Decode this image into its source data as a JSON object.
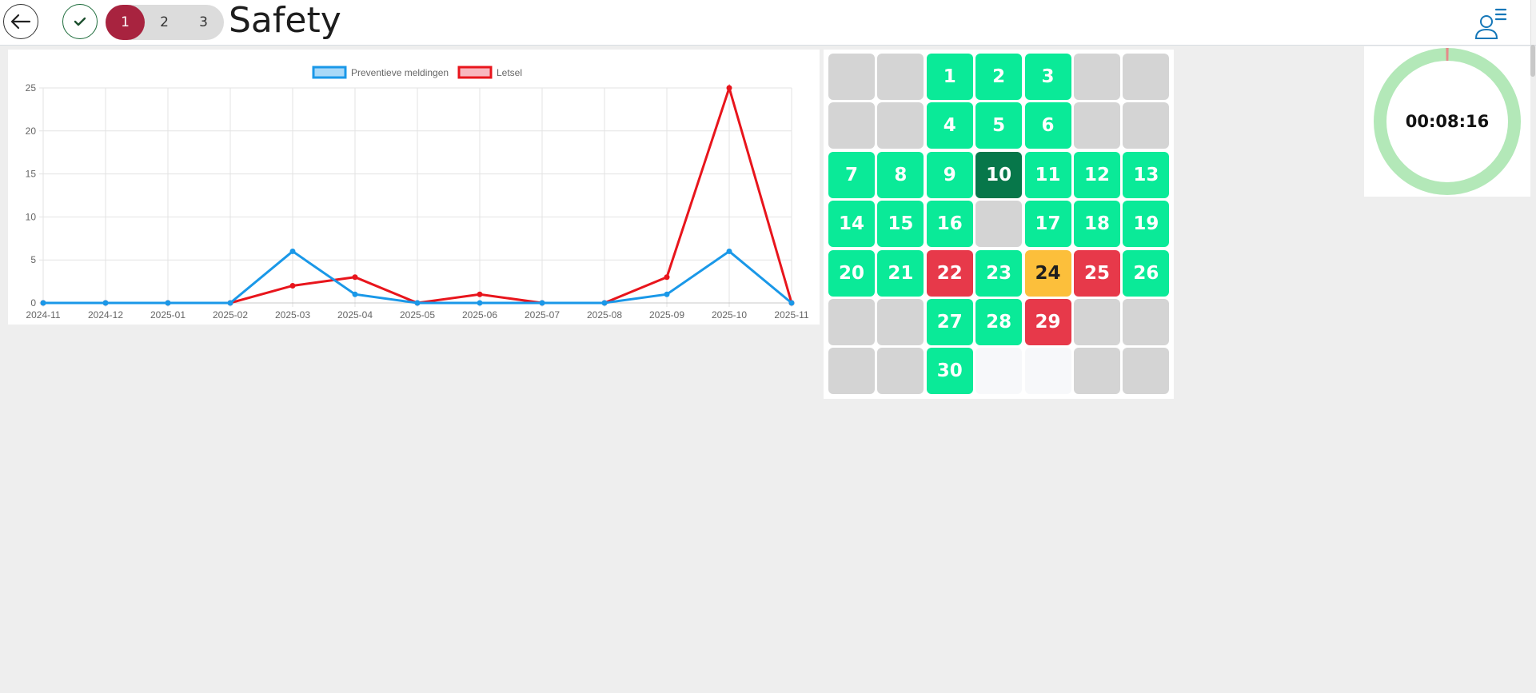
{
  "header": {
    "title": "Safety",
    "steps": [
      {
        "label": "1",
        "active": true
      },
      {
        "label": "2",
        "active": false
      },
      {
        "label": "3",
        "active": false
      }
    ],
    "icons": {
      "back": "arrow-left-icon",
      "check": "check-icon",
      "user_menu": "user-menu-icon"
    }
  },
  "colors": {
    "accent": "#a8233f",
    "series_blue": "#1a98e8",
    "series_red": "#e8151c",
    "day_ok": "#0aea98",
    "day_selected": "#07774a",
    "day_incident": "#e7394a",
    "day_warning": "#fcbf3b",
    "day_inactive": "#d4d4d4",
    "timer_ring": "#b3e8b8",
    "timer_progress": "#e58a8a"
  },
  "chart_data": {
    "type": "line",
    "x": [
      "2024-11",
      "2024-12",
      "2025-01",
      "2025-02",
      "2025-03",
      "2025-04",
      "2025-05",
      "2025-06",
      "2025-07",
      "2025-08",
      "2025-09",
      "2025-10",
      "2025-11"
    ],
    "series": [
      {
        "name": "Preventieve meldingen",
        "color": "#1a98e8",
        "values": [
          0,
          0,
          0,
          0,
          6,
          1,
          0,
          0,
          0,
          0,
          1,
          6,
          0
        ]
      },
      {
        "name": "Letsel",
        "color": "#e8151c",
        "values": [
          0,
          0,
          0,
          0,
          2,
          3,
          0,
          1,
          0,
          0,
          3,
          25,
          0
        ]
      }
    ],
    "ylim": [
      0,
      25
    ],
    "yticks": [
      0,
      5,
      10,
      15,
      20,
      25
    ],
    "grid": true,
    "legend": "top-center"
  },
  "calendar": {
    "cells": [
      {
        "label": "",
        "status": "grey"
      },
      {
        "label": "",
        "status": "grey"
      },
      {
        "label": "1",
        "status": "green"
      },
      {
        "label": "2",
        "status": "green"
      },
      {
        "label": "3",
        "status": "green"
      },
      {
        "label": "",
        "status": "grey"
      },
      {
        "label": "",
        "status": "grey"
      },
      {
        "label": "",
        "status": "grey"
      },
      {
        "label": "",
        "status": "grey"
      },
      {
        "label": "4",
        "status": "green"
      },
      {
        "label": "5",
        "status": "green"
      },
      {
        "label": "6",
        "status": "green"
      },
      {
        "label": "",
        "status": "grey"
      },
      {
        "label": "",
        "status": "grey"
      },
      {
        "label": "7",
        "status": "green"
      },
      {
        "label": "8",
        "status": "green"
      },
      {
        "label": "9",
        "status": "green"
      },
      {
        "label": "10",
        "status": "dark"
      },
      {
        "label": "11",
        "status": "green"
      },
      {
        "label": "12",
        "status": "green"
      },
      {
        "label": "13",
        "status": "green"
      },
      {
        "label": "14",
        "status": "green"
      },
      {
        "label": "15",
        "status": "green"
      },
      {
        "label": "16",
        "status": "green"
      },
      {
        "label": "",
        "status": "grey"
      },
      {
        "label": "17",
        "status": "green"
      },
      {
        "label": "18",
        "status": "green"
      },
      {
        "label": "19",
        "status": "green"
      },
      {
        "label": "20",
        "status": "green"
      },
      {
        "label": "21",
        "status": "green"
      },
      {
        "label": "22",
        "status": "red"
      },
      {
        "label": "23",
        "status": "green"
      },
      {
        "label": "24",
        "status": "yellow"
      },
      {
        "label": "25",
        "status": "red"
      },
      {
        "label": "26",
        "status": "green"
      },
      {
        "label": "",
        "status": "grey"
      },
      {
        "label": "",
        "status": "grey"
      },
      {
        "label": "27",
        "status": "green"
      },
      {
        "label": "28",
        "status": "green"
      },
      {
        "label": "29",
        "status": "red"
      },
      {
        "label": "",
        "status": "grey"
      },
      {
        "label": "",
        "status": "grey"
      },
      {
        "label": "",
        "status": "grey"
      },
      {
        "label": "",
        "status": "grey"
      },
      {
        "label": "30",
        "status": "green"
      },
      {
        "label": "",
        "status": "empty"
      },
      {
        "label": "",
        "status": "empty"
      },
      {
        "label": "",
        "status": "grey"
      },
      {
        "label": "",
        "status": "grey"
      }
    ]
  },
  "timer": {
    "value": "00:08:16",
    "progress": 0.004
  }
}
